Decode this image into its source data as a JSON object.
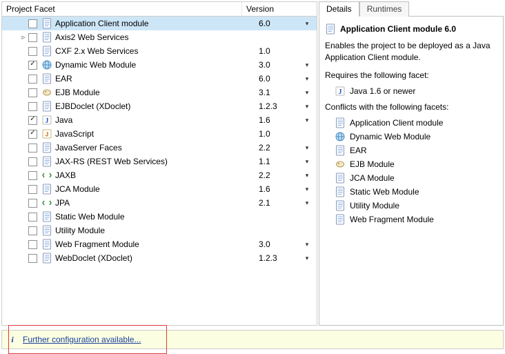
{
  "left": {
    "headers": {
      "name": "Project Facet",
      "version": "Version"
    },
    "facets": [
      {
        "name": "Application Client module",
        "version": "6.0",
        "dd": true,
        "checked": false,
        "expander": "",
        "icon": "page",
        "selected": true
      },
      {
        "name": "Axis2 Web Services",
        "version": "",
        "dd": false,
        "checked": false,
        "expander": "▹",
        "icon": "page"
      },
      {
        "name": "CXF 2.x Web Services",
        "version": "1.0",
        "dd": false,
        "checked": false,
        "expander": "",
        "icon": "page"
      },
      {
        "name": "Dynamic Web Module",
        "version": "3.0",
        "dd": true,
        "checked": true,
        "expander": "",
        "icon": "globe"
      },
      {
        "name": "EAR",
        "version": "6.0",
        "dd": true,
        "checked": false,
        "expander": "",
        "icon": "page"
      },
      {
        "name": "EJB Module",
        "version": "3.1",
        "dd": true,
        "checked": false,
        "expander": "",
        "icon": "bean"
      },
      {
        "name": "EJBDoclet (XDoclet)",
        "version": "1.2.3",
        "dd": true,
        "checked": false,
        "expander": "",
        "icon": "page"
      },
      {
        "name": "Java",
        "version": "1.6",
        "dd": true,
        "checked": true,
        "expander": "",
        "icon": "j"
      },
      {
        "name": "JavaScript",
        "version": "1.0",
        "dd": false,
        "checked": true,
        "expander": "",
        "icon": "js"
      },
      {
        "name": "JavaServer Faces",
        "version": "2.2",
        "dd": true,
        "checked": false,
        "expander": "",
        "icon": "page"
      },
      {
        "name": "JAX-RS (REST Web Services)",
        "version": "1.1",
        "dd": true,
        "checked": false,
        "expander": "",
        "icon": "page"
      },
      {
        "name": "JAXB",
        "version": "2.2",
        "dd": true,
        "checked": false,
        "expander": "",
        "icon": "tag"
      },
      {
        "name": "JCA Module",
        "version": "1.6",
        "dd": true,
        "checked": false,
        "expander": "",
        "icon": "page"
      },
      {
        "name": "JPA",
        "version": "2.1",
        "dd": true,
        "checked": false,
        "expander": "",
        "icon": "tag"
      },
      {
        "name": "Static Web Module",
        "version": "",
        "dd": false,
        "checked": false,
        "expander": "",
        "icon": "page"
      },
      {
        "name": "Utility Module",
        "version": "",
        "dd": false,
        "checked": false,
        "expander": "",
        "icon": "page"
      },
      {
        "name": "Web Fragment Module",
        "version": "3.0",
        "dd": true,
        "checked": false,
        "expander": "",
        "icon": "page"
      },
      {
        "name": "WebDoclet (XDoclet)",
        "version": "1.2.3",
        "dd": true,
        "checked": false,
        "expander": "",
        "icon": "page"
      }
    ]
  },
  "right": {
    "tabs": {
      "details": "Details",
      "runtimes": "Runtimes"
    },
    "title": "Application Client module 6.0",
    "description": "Enables the project to be deployed as a Java Application Client module.",
    "requires_label": "Requires the following facet:",
    "requires": [
      {
        "name": "Java 1.6 or newer",
        "icon": "j"
      }
    ],
    "conflicts_label": "Conflicts with the following facets:",
    "conflicts": [
      {
        "name": "Application Client module",
        "icon": "page"
      },
      {
        "name": "Dynamic Web Module",
        "icon": "globe"
      },
      {
        "name": "EAR",
        "icon": "page"
      },
      {
        "name": "EJB Module",
        "icon": "bean"
      },
      {
        "name": "JCA Module",
        "icon": "page"
      },
      {
        "name": "Static Web Module",
        "icon": "page"
      },
      {
        "name": "Utility Module",
        "icon": "page"
      },
      {
        "name": "Web Fragment Module",
        "icon": "page"
      }
    ]
  },
  "bottom": {
    "link": "Further configuration available..."
  }
}
